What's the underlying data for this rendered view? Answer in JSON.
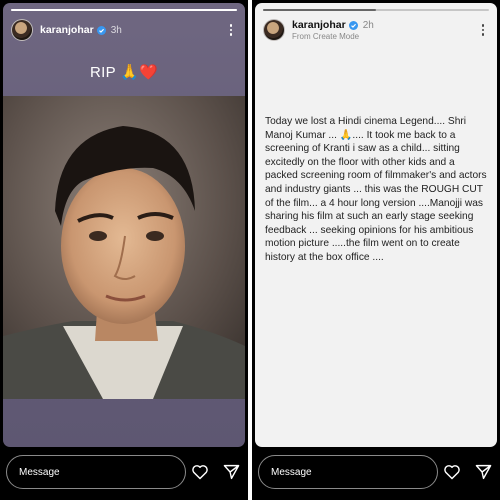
{
  "left_story": {
    "username": "karanjohar",
    "time": "3h",
    "progress": 1.0,
    "caption": "RIP 🙏❤️",
    "photo_alt": "Vintage portrait photo"
  },
  "right_story": {
    "username": "karanjohar",
    "time": "2h",
    "subline": "From Create Mode",
    "progress": 0.5,
    "text": "Today we lost a Hindi cinema Legend.... Shri Manoj Kumar ... 🙏.... It took me back to a screening of Kranti i saw as a child... sitting excitedly on the floor with other kids and a packed screening room of filmmaker's and actors and industry giants ... this was the ROUGH CUT of the film... a 4 hour long version ....Manojji was sharing his film at such an early stage seeking feedback ... seeking opinions for his ambitious motion picture .....the film went on to create history at the box office ...."
  },
  "reply_bar": {
    "message_placeholder": "Message",
    "like_icon": "heart-icon",
    "share_icon": "send-icon"
  }
}
